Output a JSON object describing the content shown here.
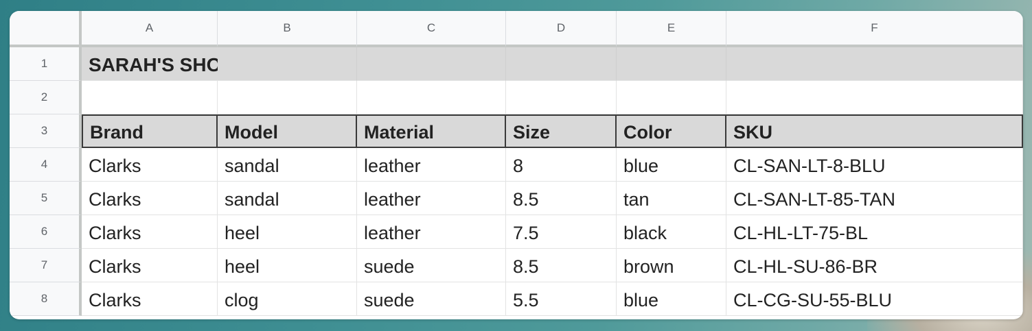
{
  "columns": [
    "A",
    "B",
    "C",
    "D",
    "E",
    "F"
  ],
  "rows": [
    "1",
    "2",
    "3",
    "4",
    "5",
    "6",
    "7",
    "8"
  ],
  "sheet_title": "SARAH'S SHOE STORE",
  "headers": [
    "Brand",
    "Model",
    "Material",
    "Size",
    "Color",
    "SKU"
  ],
  "data": [
    [
      "Clarks",
      "sandal",
      "leather",
      "8",
      "blue",
      "CL-SAN-LT-8-BLU"
    ],
    [
      "Clarks",
      "sandal",
      "leather",
      "8.5",
      "tan",
      "CL-SAN-LT-85-TAN"
    ],
    [
      "Clarks",
      "heel",
      "leather",
      "7.5",
      "black",
      "CL-HL-LT-75-BL"
    ],
    [
      "Clarks",
      "heel",
      "suede",
      "8.5",
      "brown",
      "CL-HL-SU-86-BR"
    ],
    [
      "Clarks",
      "clog",
      "suede",
      "5.5",
      "blue",
      "CL-CG-SU-55-BLU"
    ]
  ]
}
